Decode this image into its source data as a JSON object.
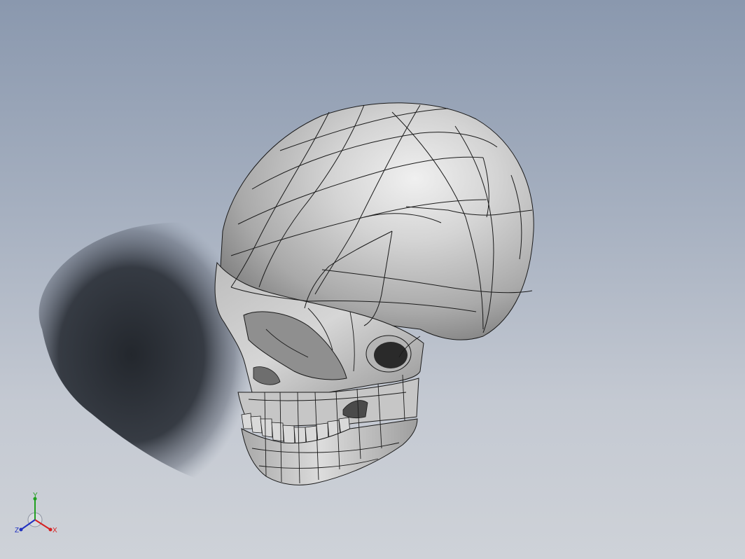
{
  "viewport": {
    "background_top": "#8a98ae",
    "background_bottom": "#ced2d8"
  },
  "model": {
    "name": "skull",
    "surface_color": "#c8c8c8",
    "edge_color": "#1a1a1a",
    "shadow_color": "#2b2f36"
  },
  "triad": {
    "y_label": "Y",
    "x_label": "X",
    "z_label": "Z",
    "x_color": "#d62020",
    "y_color": "#20a020",
    "z_color": "#2030c0"
  }
}
